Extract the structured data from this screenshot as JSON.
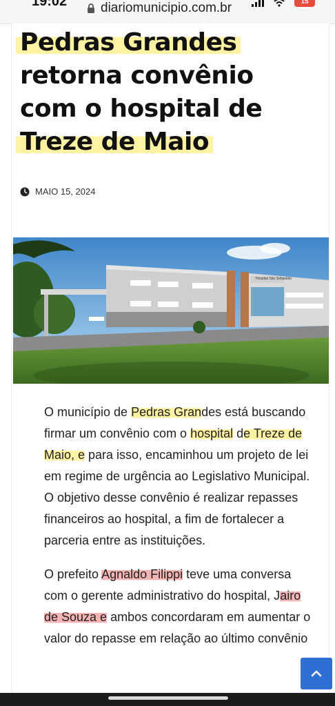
{
  "status_bar": {
    "time": "19:02",
    "url": "diariomunicipio.com.br",
    "battery": "15"
  },
  "article": {
    "title_lines": [
      "Pedras Grandes",
      "retorna convênio",
      "com o hospital de",
      "Treze de Maio"
    ],
    "date": "MAIO 15, 2024",
    "image_signage": "Hospital São Sebastião",
    "paragraphs": [
      {
        "segments": [
          {
            "text": "O município de ",
            "mark": ""
          },
          {
            "text": "Pedras Gran",
            "mark": "yellow"
          },
          {
            "text": "des está buscando firmar um convênio com o ",
            "mark": ""
          },
          {
            "text": "hospital",
            "mark": "yellow"
          },
          {
            "text": " d",
            "mark": ""
          },
          {
            "text": "e Treze de Maio, e",
            "mark": "yellow"
          },
          {
            "text": " para isso, encaminhou um projeto de lei em regime de urgência ao Legislativo Municipal. O objetivo desse convênio é realizar repasses financeiros ao hospital, a fim de fortalecer a parceria entre as instituições.",
            "mark": ""
          }
        ]
      },
      {
        "segments": [
          {
            "text": "O prefeito ",
            "mark": ""
          },
          {
            "text": "Agnaldo Filippi",
            "mark": "red"
          },
          {
            "text": " teve uma conversa com o gerente administrativo do hospital, J",
            "mark": ""
          },
          {
            "text": "airo de Souza e",
            "mark": "red"
          },
          {
            "text": " ambos concordaram em aumentar o valor do repasse em relação ao último convênio",
            "mark": ""
          }
        ]
      }
    ]
  },
  "icons": {
    "lock": "lock-icon",
    "clock": "clock-icon",
    "scroll_top": "chevron-up-icon"
  },
  "colors": {
    "highlight_yellow": "#fff2a3",
    "highlight_red": "#f7b4b4",
    "scroll_button": "#2d6fd3"
  }
}
